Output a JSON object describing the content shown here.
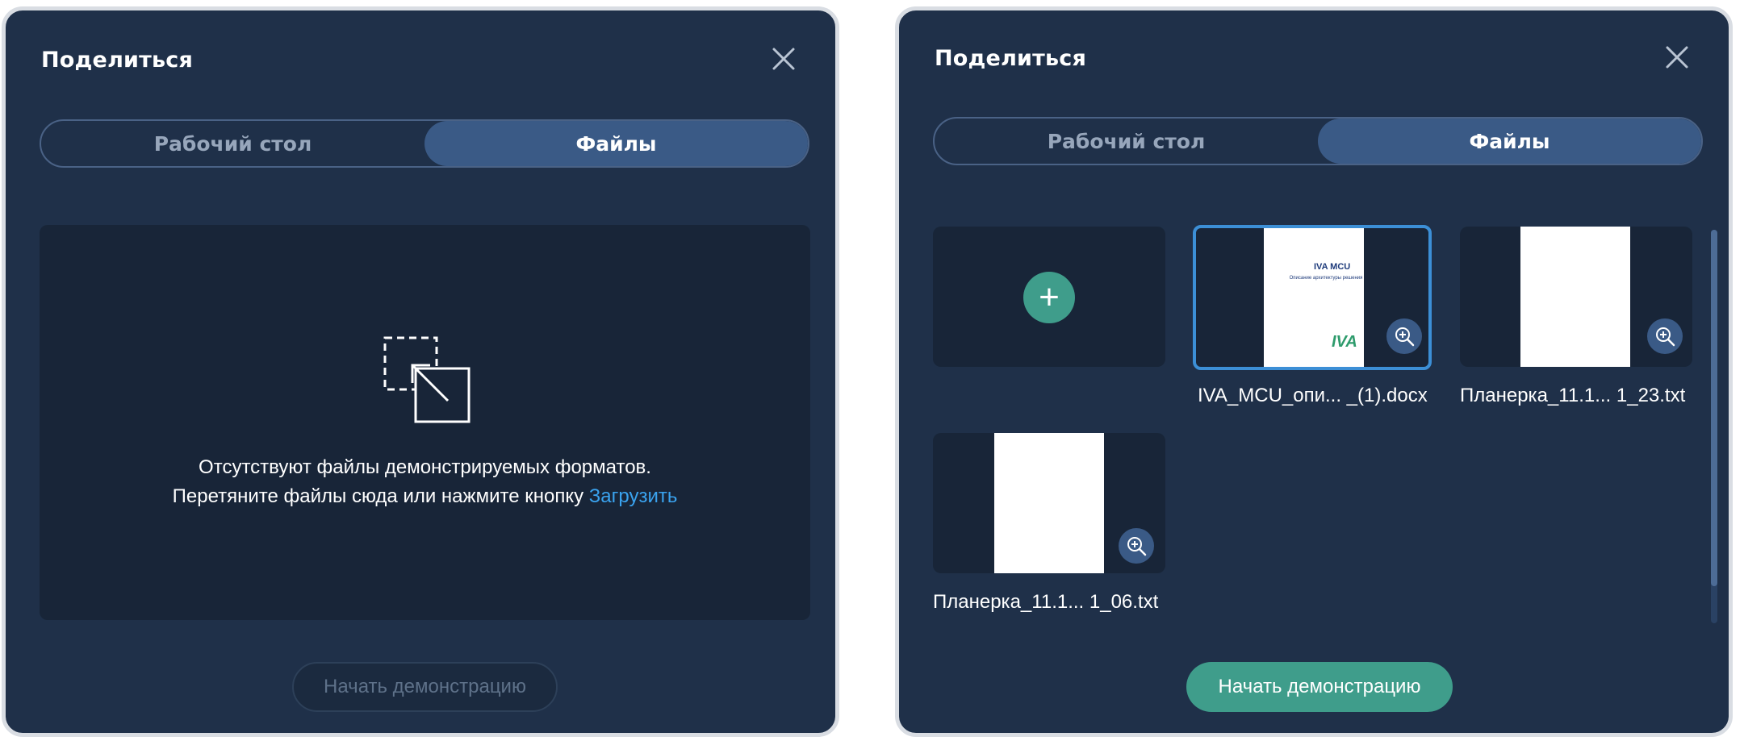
{
  "dialog_empty": {
    "title": "Поделиться",
    "tabs": [
      "Рабочий стол",
      "Файлы"
    ],
    "active_tab": "Файлы",
    "empty_line1": "Отсутствуют файлы демонстрируемых форматов.",
    "empty_line2": "Перетяните файлы сюда или нажмите кнопку",
    "upload_link": "Загрузить",
    "start_button": "Начать демонстрацию",
    "start_enabled": false
  },
  "dialog_files": {
    "title": "Поделиться",
    "tabs": [
      "Рабочий стол",
      "Файлы"
    ],
    "active_tab": "Файлы",
    "add_symbol": "+",
    "files": [
      {
        "name": "IVA_MCU_опи... _(1).docx",
        "selected": true,
        "preview_title": "IVA MCU",
        "preview_subtitle": "Описание архитектуры решения",
        "preview_logo": "IVA"
      },
      {
        "name": "Планерка_11.1... 1_23.txt",
        "selected": false
      },
      {
        "name": "Планерка_11.1... 1_06.txt",
        "selected": false
      }
    ],
    "start_button": "Начать демонстрацию",
    "start_enabled": true
  },
  "colors": {
    "dialog_bg": "#1f3049",
    "panel_bg": "#182538",
    "tab_active_bg": "#3a5a86",
    "accent_green": "#3f9d8b",
    "link_blue": "#3aa3ef",
    "selected_border": "#3c8fd6"
  },
  "icons": {
    "close": "close-icon",
    "drop": "screen-share-icon",
    "add": "plus-icon",
    "zoom": "zoom-in-icon"
  }
}
